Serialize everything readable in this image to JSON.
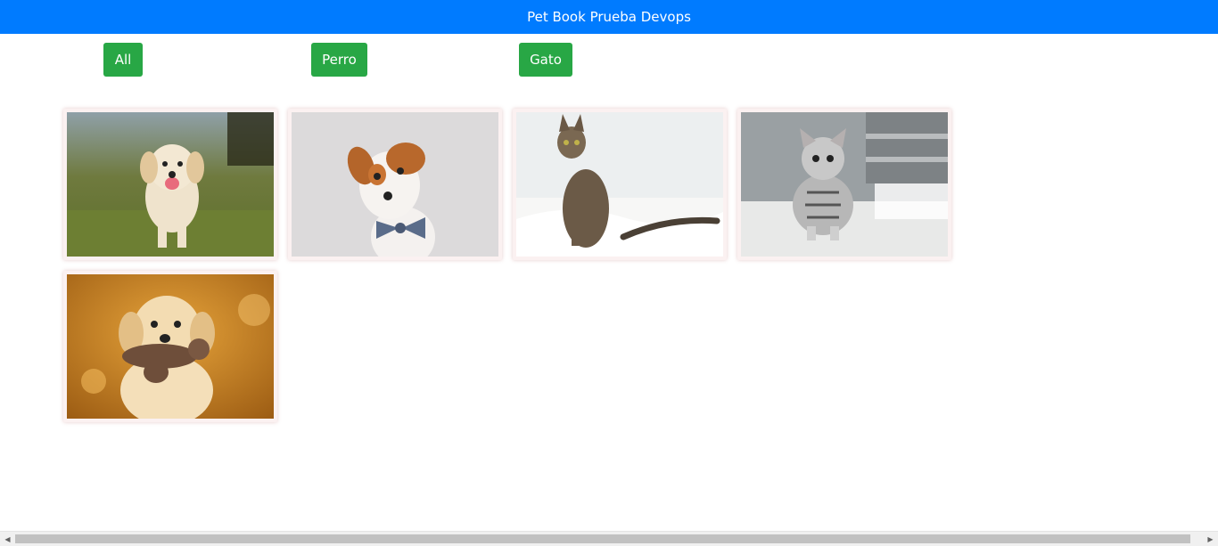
{
  "header": {
    "title": "Pet Book Prueba Devops",
    "bg_color": "#007bff"
  },
  "filters": {
    "all_label": "All",
    "perro_label": "Perro",
    "gato_label": "Gato",
    "button_color": "#28a745"
  },
  "gallery": {
    "items": [
      {
        "subject": "golden retriever puppy walking on grass"
      },
      {
        "subject": "jack russell dog with bow tie"
      },
      {
        "subject": "tabby cat sitting on white blanket"
      },
      {
        "subject": "silver tabby kitten"
      },
      {
        "subject": "golden retriever puppy holding plush toy"
      }
    ]
  },
  "scrollbar": {
    "left_arrow": "◀",
    "right_arrow": "▶"
  }
}
